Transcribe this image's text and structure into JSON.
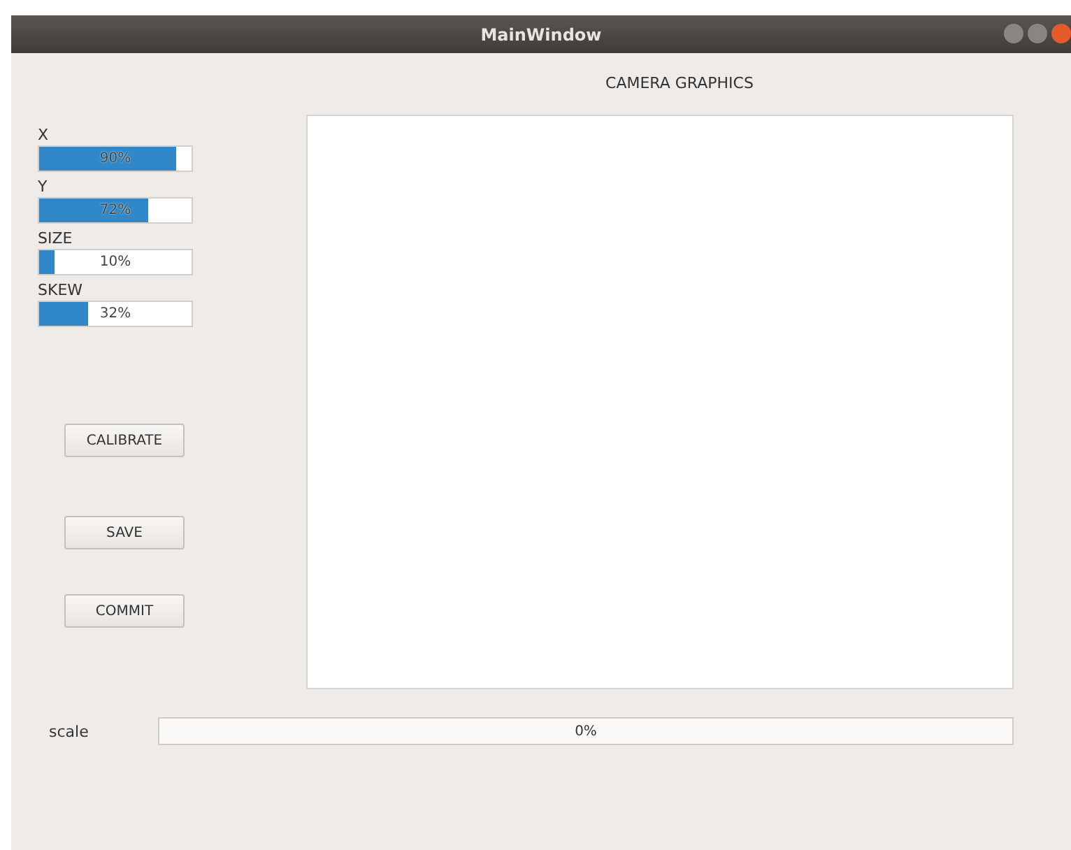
{
  "window": {
    "title": "MainWindow"
  },
  "sliders": [
    {
      "label": "X",
      "level": 0.9,
      "reading": "90%"
    },
    {
      "label": "Y",
      "level": 0.72,
      "reading": "72%"
    },
    {
      "label": "SIZE",
      "level": 0.1,
      "reading": "10%"
    },
    {
      "label": "SKEW",
      "level": 0.32,
      "reading": "32%"
    }
  ],
  "buttons": [
    "CALIBRATE",
    "SAVE",
    "COMMIT"
  ],
  "graphics": {
    "title": "CAMERA GRAPHICS"
  },
  "scale": {
    "label": "scale",
    "level": 0,
    "reading": "0%"
  }
}
